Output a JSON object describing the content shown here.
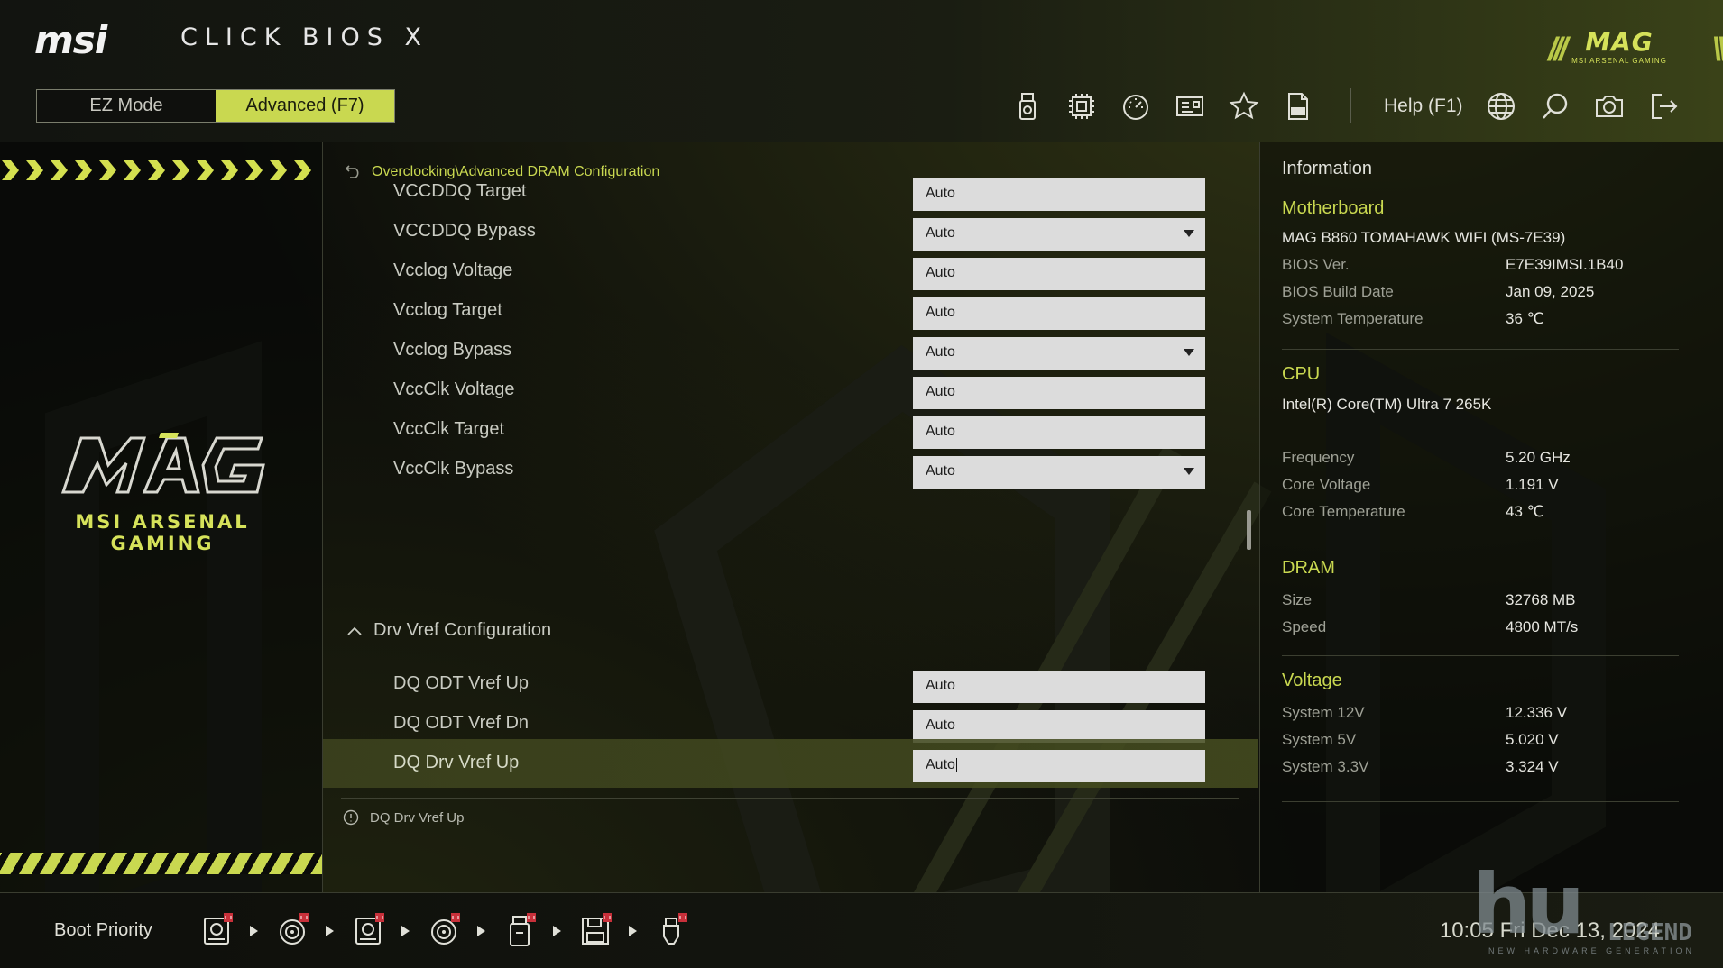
{
  "header": {
    "brand": "msi",
    "app_title": "CLICK BIOS X",
    "modes": {
      "ez": "EZ Mode",
      "advanced": "Advanced (F7)"
    },
    "help": "Help (F1)",
    "toolbar_icons": [
      "usb-drive-icon",
      "cpu-chip-icon",
      "speedometer-icon",
      "hardware-monitor-icon",
      "favorites-star-icon",
      "log-file-icon",
      "language-globe-icon",
      "search-icon",
      "screenshot-camera-icon",
      "exit-icon"
    ],
    "mag_mark": "MAG",
    "mag_sub": "MSI ARSENAL GAMING"
  },
  "left": {
    "logo_text": "MAG",
    "arsenal_text": "MSI ARSENAL GAMING"
  },
  "center": {
    "breadcrumb": "Overclocking\\Advanced DRAM Configuration",
    "rows": [
      {
        "label": "VCCDDQ Target",
        "value": "Auto",
        "dropdown": false
      },
      {
        "label": "VCCDDQ Bypass",
        "value": "Auto",
        "dropdown": true
      },
      {
        "label": "Vcclog Voltage",
        "value": "Auto",
        "dropdown": false
      },
      {
        "label": "Vcclog Target",
        "value": "Auto",
        "dropdown": false
      },
      {
        "label": "Vcclog Bypass",
        "value": "Auto",
        "dropdown": true
      },
      {
        "label": "VccClk Voltage",
        "value": "Auto",
        "dropdown": false
      },
      {
        "label": "VccClk Target",
        "value": "Auto",
        "dropdown": false
      },
      {
        "label": "VccClk Bypass",
        "value": "Auto",
        "dropdown": true
      }
    ],
    "section": "Drv Vref Configuration",
    "section_rows": [
      {
        "label": "DQ ODT Vref Up",
        "value": "Auto"
      },
      {
        "label": "DQ ODT Vref Dn",
        "value": "Auto"
      },
      {
        "label": "DQ Drv Vref Up",
        "value": "Auto",
        "selected": true
      }
    ],
    "help_text": "DQ Drv Vref Up"
  },
  "info": {
    "title": "Information",
    "motherboard": {
      "title": "Motherboard",
      "model": "MAG B860 TOMAHAWK WIFI (MS-7E39)",
      "items": [
        {
          "key": "BIOS Ver.",
          "value": "E7E39IMSI.1B40"
        },
        {
          "key": "BIOS Build Date",
          "value": "Jan 09, 2025"
        },
        {
          "key": "System Temperature",
          "value": "36 ℃"
        }
      ]
    },
    "cpu": {
      "title": "CPU",
      "model": "Intel(R) Core(TM) Ultra 7 265K",
      "items": [
        {
          "key": "Frequency",
          "value": "5.20 GHz"
        },
        {
          "key": "Core Voltage",
          "value": "1.191 V"
        },
        {
          "key": "Core Temperature",
          "value": "43 ℃"
        }
      ]
    },
    "dram": {
      "title": "DRAM",
      "items": [
        {
          "key": "Size",
          "value": "32768 MB"
        },
        {
          "key": "Speed",
          "value": "4800 MT/s"
        }
      ]
    },
    "voltage": {
      "title": "Voltage",
      "items": [
        {
          "key": "System 12V",
          "value": "12.336 V"
        },
        {
          "key": "System 5V",
          "value": "5.020 V"
        },
        {
          "key": "System 3.3V",
          "value": "3.324 V"
        }
      ]
    }
  },
  "footer": {
    "boot_label": "Boot Priority",
    "boot_devices": [
      "hdd-icon",
      "optical-disc-icon",
      "hdd-icon",
      "optical-disc-icon",
      "usb-drive-icon",
      "floppy-icon",
      "usb-stick-icon"
    ],
    "clock": "10:05  Fri  Dec 13, 2024"
  },
  "watermark": {
    "big": "hu",
    "legend": "LEGEND",
    "sub": "NEW HARDWARE GENERATION"
  },
  "colors": {
    "accent": "#c9d850",
    "panel_bg": "#0c0d0a",
    "field_bg": "#dcdcdc"
  }
}
